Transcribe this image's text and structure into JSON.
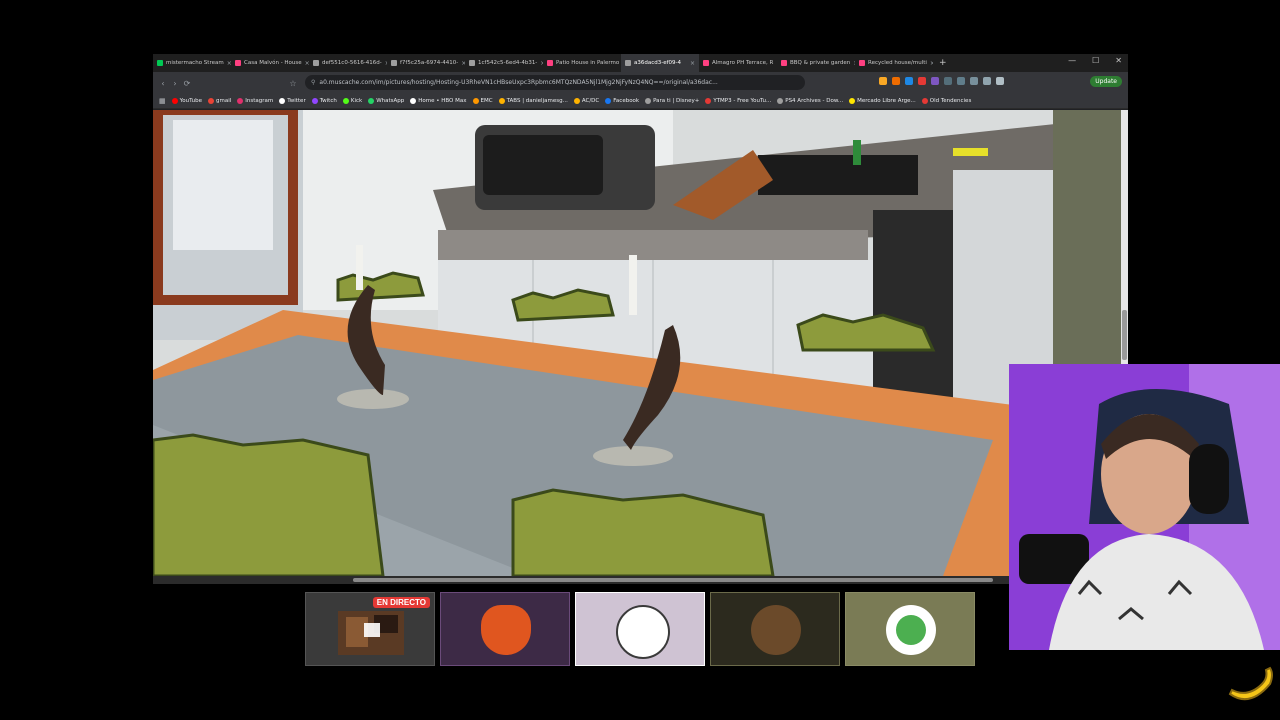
{
  "browser": {
    "tabs": [
      {
        "label": "mistermacho Stream",
        "color": "#00c853"
      },
      {
        "label": "Casa Malvón - House",
        "color": "#ff4081"
      },
      {
        "label": "def551c0-5616-416d-",
        "color": "#9e9e9e"
      },
      {
        "label": "f7f5c25a-6974-4410-",
        "color": "#9e9e9e"
      },
      {
        "label": "1cf542c5-6ed4-4b31-",
        "color": "#9e9e9e"
      },
      {
        "label": "Patio House in Palermo",
        "color": "#ff4081"
      },
      {
        "label": "a36dacd3-ef09-4",
        "color": "#9e9e9e",
        "active": true
      },
      {
        "label": "Almagro PH Terrace, R",
        "color": "#ff4081"
      },
      {
        "label": "BBQ & private garden",
        "color": "#ff4081"
      },
      {
        "label": "Recycled house/multi",
        "color": "#ff4081"
      }
    ],
    "new_tab": "+",
    "window_controls": [
      "—",
      "☐",
      "✕"
    ],
    "url": "a0.muscache.com/im/pictures/hosting/Hosting-U3RheVN1cHBseUxpc3Rpbmc6MTQzNDA5Njl1Mjg2NjFyNzQ4NQ==/original/a36dac...",
    "update_label": "Update",
    "bookmarks": [
      {
        "label": "YouTube",
        "color": "#ff0000"
      },
      {
        "label": "gmail",
        "color": "#ea4335"
      },
      {
        "label": "Instagram",
        "color": "#e1306c"
      },
      {
        "label": "Twitter",
        "color": "#ffffff"
      },
      {
        "label": "Twitch",
        "color": "#9146ff"
      },
      {
        "label": "Kick",
        "color": "#53fc18"
      },
      {
        "label": "WhatsApp",
        "color": "#25d366"
      },
      {
        "label": "Home • HBO Max",
        "color": "#ffffff"
      },
      {
        "label": "EMC",
        "color": "#ff9800"
      },
      {
        "label": "TABS | danieljamesg...",
        "color": "#ffb300"
      },
      {
        "label": "AC/DC",
        "color": "#ffb300"
      },
      {
        "label": "Facebook",
        "color": "#1877f2"
      },
      {
        "label": "Para ti | Disney+",
        "color": "#9e9e9e"
      },
      {
        "label": "YTMP3 - Free YouTu...",
        "color": "#e53935"
      },
      {
        "label": "PS4 Archives - Dow...",
        "color": "#9e9e9e"
      },
      {
        "label": "Mercado Libre Arge...",
        "color": "#ffe600"
      },
      {
        "label": "Old Tendencies",
        "color": "#e53935"
      }
    ]
  },
  "stream": {
    "live_badge": "EN DIRECTO"
  }
}
